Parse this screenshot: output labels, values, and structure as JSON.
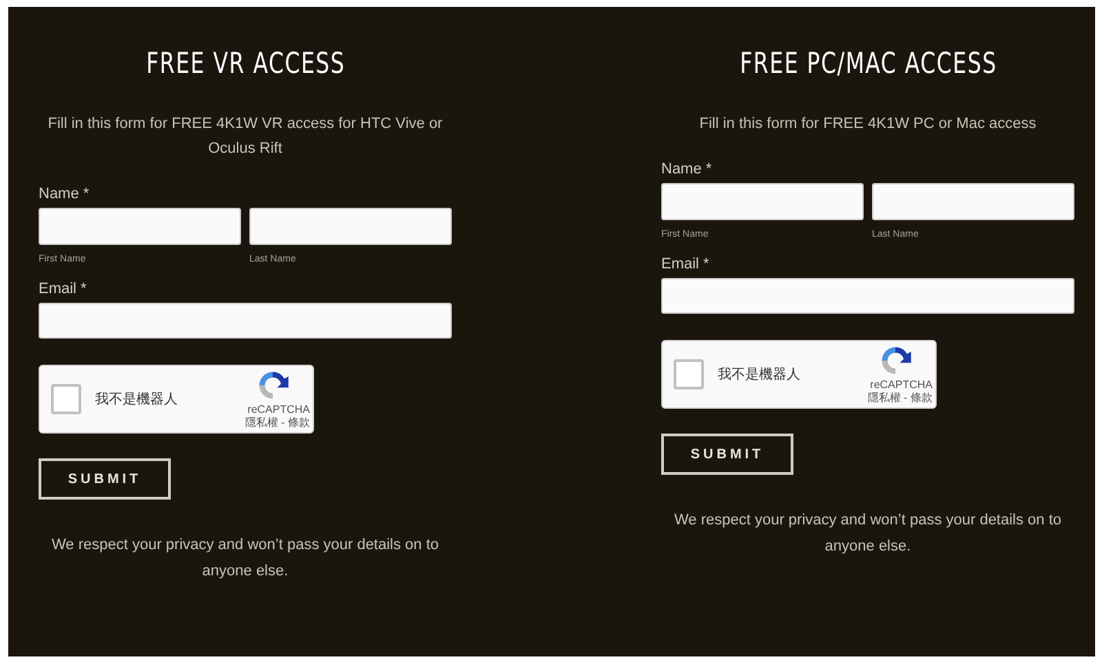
{
  "forms": [
    {
      "title": "FREE VR ACCESS",
      "description": "Fill in this form for FREE 4K1W VR access for HTC Vive or Oculus Rift",
      "name_label": "Name *",
      "first_name_label": "First Name",
      "last_name_label": "Last Name",
      "email_label": "Email *",
      "captcha": {
        "checked": false,
        "label": "我不是機器人",
        "brand": "reCAPTCHA",
        "links": "隱私權 - 條款"
      },
      "submit": "SUBMIT",
      "privacy": "We respect your privacy and won’t pass your details on to anyone else."
    },
    {
      "title": "FREE PC/MAC ACCESS",
      "description": "Fill in this form for FREE 4K1W PC or Mac access",
      "name_label": "Name *",
      "first_name_label": "First Name",
      "last_name_label": "Last Name",
      "email_label": "Email *",
      "captcha": {
        "checked": false,
        "label": "我不是機器人",
        "brand": "reCAPTCHA",
        "links": "隱私權 - 條款"
      },
      "submit": "SUBMIT",
      "privacy": "We respect your privacy and won’t pass your details on to anyone else."
    }
  ]
}
